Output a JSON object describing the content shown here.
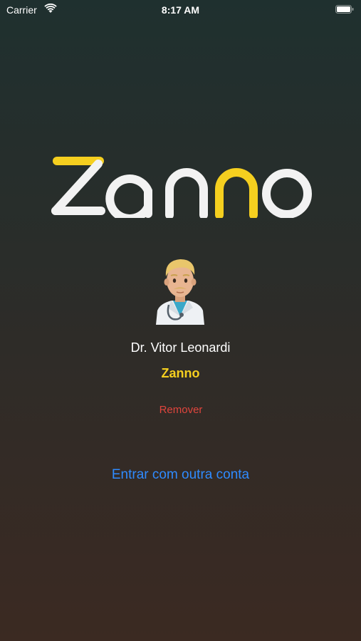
{
  "status_bar": {
    "carrier": "Carrier",
    "time": "8:17 AM",
    "icons": [
      "wifi-icon",
      "battery-icon"
    ]
  },
  "logo": {
    "text": "Zanno",
    "colors": {
      "white": "#f2f2f2",
      "yellow": "#f5cf1f"
    }
  },
  "account": {
    "avatar": "man-health-worker-emoji",
    "name": "Dr. Vitor Leonardi",
    "organization": "Zanno",
    "remove_label": "Remover"
  },
  "actions": {
    "other_account_label": "Entrar com outra conta"
  },
  "colors": {
    "accent_link": "#2f8bff",
    "destructive": "#e0453d",
    "brand_yellow": "#f5cf1f",
    "background_top": "#1f302f",
    "background_bottom": "#3b2a22"
  }
}
